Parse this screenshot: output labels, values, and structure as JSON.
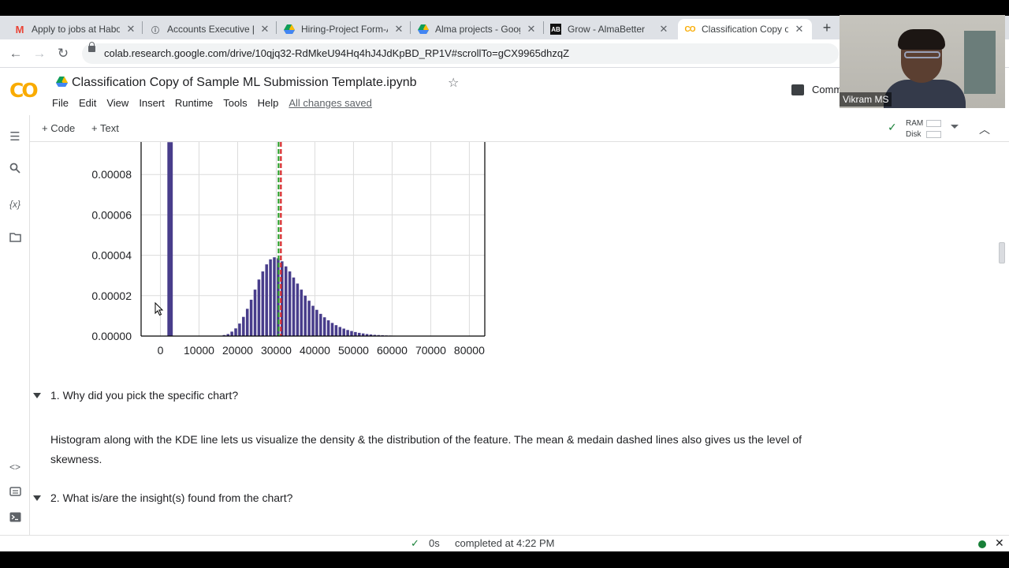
{
  "browser": {
    "tabs": [
      {
        "title": "Apply to jobs at Habo",
        "icon": "gmail-icon"
      },
      {
        "title": "Accounts Executive [M",
        "icon": "info-icon"
      },
      {
        "title": "Hiring-Project Form-A",
        "icon": "google-drive-icon"
      },
      {
        "title": "Alma projects - Goog",
        "icon": "google-drive-icon"
      },
      {
        "title": "Grow - AlmaBetter",
        "icon": "almabetter-icon"
      },
      {
        "title": "Classification Copy of",
        "icon": "colab-icon",
        "active": true
      }
    ],
    "url": "colab.research.google.com/drive/10qjq32-RdMkeU94Hq4hJ4JdKpBD_RP1V#scrollTo=gCX9965dhzqZ"
  },
  "colab": {
    "logo": "CO",
    "title": "Classification Copy of Sample ML Submission Template.ipynb",
    "menu": [
      "File",
      "Edit",
      "View",
      "Insert",
      "Runtime",
      "Tools",
      "Help"
    ],
    "saved_status": "All changes saved",
    "comment_label": "Comm",
    "add_code": "+ Code",
    "add_text": "+ Text",
    "ram_label": "RAM",
    "disk_label": "Disk"
  },
  "webcam": {
    "name": "Vikram MS"
  },
  "chart_data": {
    "type": "bar",
    "title": "",
    "xlabel": "",
    "ylabel": "",
    "xlim": [
      -5000,
      84000
    ],
    "ylim": [
      0,
      0.0001
    ],
    "x_ticks": [
      "0",
      "10000",
      "20000",
      "30000",
      "40000",
      "50000",
      "60000",
      "70000",
      "80000"
    ],
    "y_ticks": [
      "0.00000",
      "0.00002",
      "0.00004",
      "0.00006",
      "0.00008"
    ],
    "bin_width": 1000,
    "bar_color": "#483d8b",
    "bins": [
      {
        "x": 2500,
        "y": 9.6e-05
      },
      {
        "x": 16500,
        "y": 5e-07
      },
      {
        "x": 17500,
        "y": 1e-06
      },
      {
        "x": 18500,
        "y": 2.2e-06
      },
      {
        "x": 19500,
        "y": 3.8e-06
      },
      {
        "x": 20500,
        "y": 6.2e-06
      },
      {
        "x": 21500,
        "y": 9.5e-06
      },
      {
        "x": 22500,
        "y": 1.35e-05
      },
      {
        "x": 23500,
        "y": 1.8e-05
      },
      {
        "x": 24500,
        "y": 2.3e-05
      },
      {
        "x": 25500,
        "y": 2.8e-05
      },
      {
        "x": 26500,
        "y": 3.2e-05
      },
      {
        "x": 27500,
        "y": 3.55e-05
      },
      {
        "x": 28500,
        "y": 3.8e-05
      },
      {
        "x": 29500,
        "y": 3.9e-05
      },
      {
        "x": 30500,
        "y": 3.85e-05
      },
      {
        "x": 31500,
        "y": 3.7e-05
      },
      {
        "x": 32500,
        "y": 3.45e-05
      },
      {
        "x": 33500,
        "y": 3.2e-05
      },
      {
        "x": 34500,
        "y": 2.9e-05
      },
      {
        "x": 35500,
        "y": 2.6e-05
      },
      {
        "x": 36500,
        "y": 2.3e-05
      },
      {
        "x": 37500,
        "y": 2e-05
      },
      {
        "x": 38500,
        "y": 1.75e-05
      },
      {
        "x": 39500,
        "y": 1.5e-05
      },
      {
        "x": 40500,
        "y": 1.3e-05
      },
      {
        "x": 41500,
        "y": 1.1e-05
      },
      {
        "x": 42500,
        "y": 9.3e-06
      },
      {
        "x": 43500,
        "y": 7.8e-06
      },
      {
        "x": 44500,
        "y": 6.5e-06
      },
      {
        "x": 45500,
        "y": 5.4e-06
      },
      {
        "x": 46500,
        "y": 4.5e-06
      },
      {
        "x": 47500,
        "y": 3.7e-06
      },
      {
        "x": 48500,
        "y": 3e-06
      },
      {
        "x": 49500,
        "y": 2.5e-06
      },
      {
        "x": 50500,
        "y": 2e-06
      },
      {
        "x": 51500,
        "y": 1.6e-06
      },
      {
        "x": 52500,
        "y": 1.3e-06
      },
      {
        "x": 53500,
        "y": 1e-06
      },
      {
        "x": 54500,
        "y": 8e-07
      },
      {
        "x": 55500,
        "y": 6e-07
      },
      {
        "x": 56500,
        "y": 5e-07
      },
      {
        "x": 57500,
        "y": 4e-07
      },
      {
        "x": 58500,
        "y": 3e-07
      },
      {
        "x": 59500,
        "y": 2.5e-07
      },
      {
        "x": 60500,
        "y": 2e-07
      },
      {
        "x": 61500,
        "y": 1.5e-07
      },
      {
        "x": 62500,
        "y": 1e-07
      }
    ],
    "mean_line": {
      "x": 31200,
      "color": "#d62728",
      "style": "dashed"
    },
    "median_line": {
      "x": 30600,
      "color": "#2ca02c",
      "style": "dashed"
    },
    "grid": true
  },
  "cells": {
    "q1": "1. Why did you pick the specific chart?",
    "a1": "Histogram along with the KDE line lets us visualize the density & the distribution of the feature. The mean & medain dashed lines also gives us the level of skewness.",
    "q2": "2. What is/are the insight(s) found from the chart?"
  },
  "status": {
    "duration": "0s",
    "completed": "completed at 4:22 PM"
  }
}
